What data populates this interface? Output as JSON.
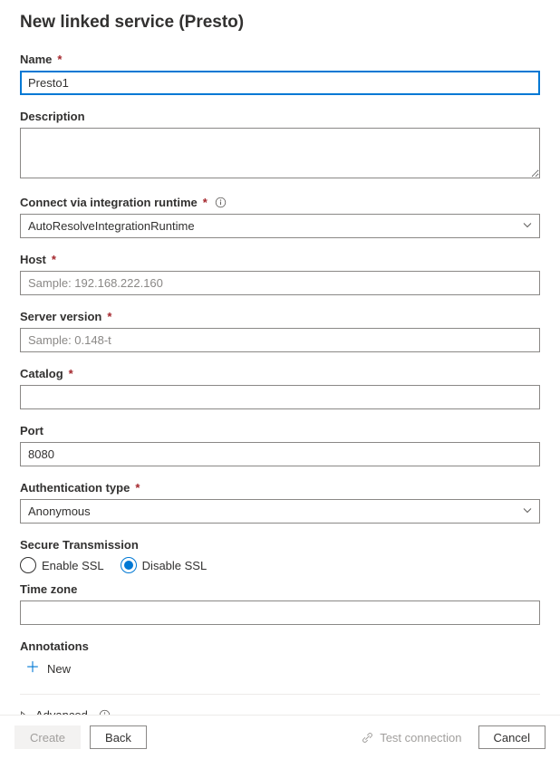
{
  "title": "New linked service (Presto)",
  "fields": {
    "name": {
      "label": "Name",
      "value": "Presto1",
      "required": true
    },
    "description": {
      "label": "Description",
      "value": ""
    },
    "runtime": {
      "label": "Connect via integration runtime",
      "value": "AutoResolveIntegrationRuntime",
      "required": true
    },
    "host": {
      "label": "Host",
      "placeholder": "Sample: 192.168.222.160",
      "value": "",
      "required": true
    },
    "serverVersion": {
      "label": "Server version",
      "placeholder": "Sample: 0.148-t",
      "value": "",
      "required": true
    },
    "catalog": {
      "label": "Catalog",
      "value": "",
      "required": true
    },
    "port": {
      "label": "Port",
      "value": "8080"
    },
    "authType": {
      "label": "Authentication type",
      "value": "Anonymous",
      "required": true
    },
    "secureTransmission": {
      "label": "Secure Transmission",
      "options": {
        "enable": "Enable SSL",
        "disable": "Disable SSL"
      },
      "selected": "disable"
    },
    "timezone": {
      "label": "Time zone",
      "value": ""
    },
    "annotations": {
      "label": "Annotations",
      "newLabel": "New"
    }
  },
  "advanced": {
    "label": "Advanced"
  },
  "footer": {
    "create": "Create",
    "back": "Back",
    "testConnection": "Test connection",
    "cancel": "Cancel"
  }
}
